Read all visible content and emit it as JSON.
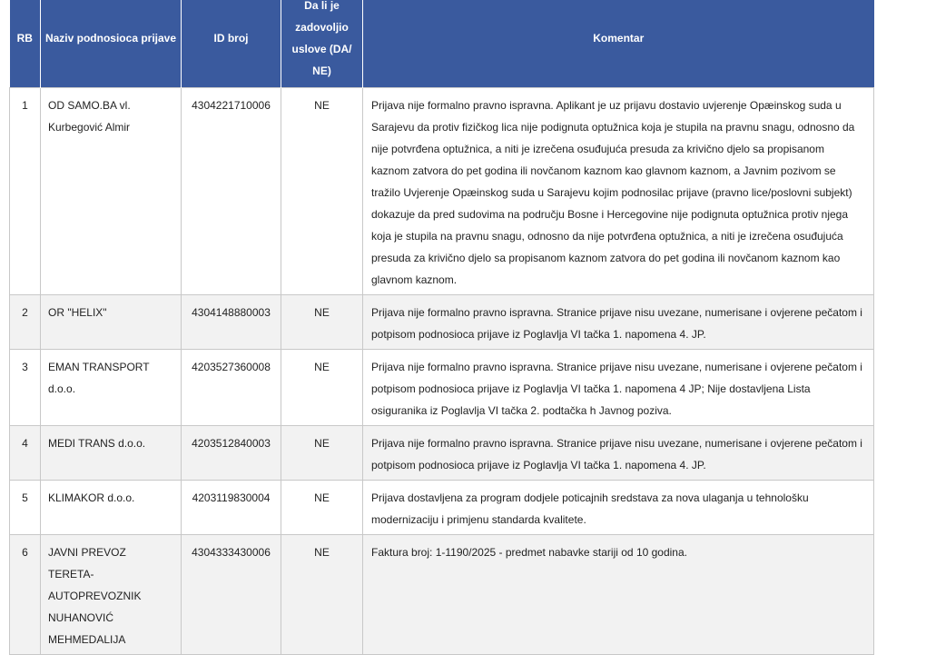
{
  "table": {
    "headers": {
      "rb": "RB",
      "naziv": "Naziv podnosioca prijave",
      "id": "ID broj",
      "da": "Da li je zadovoljio uslove (DA/ NE)",
      "komentar": "Komentar"
    },
    "rows": [
      {
        "rb": "1",
        "naziv": "OD SAMO.BA vl. Kurbegović Almir",
        "id": "4304221710006",
        "da": "NE",
        "komentar": "Prijava nije formalno pravno ispravna. Aplikant je uz prijavu dostavio uvjerenje Opæinskog suda u Sarajevu da protiv fizičkog lica nije podignuta optužnica koja je stupila na pravnu snagu, odnosno da nije potvrđena optužnica, a niti je izrečena osuđujuća presuda za krivično djelo sa propisanom kaznom zatvora do pet godina ili novčanom kaznom kao glavnom kaznom, a Javnim pozivom se tražilo Uvjerenje Opæinskog suda u Sarajevu kojim podnosilac prijave (pravno lice/poslovni subjekt) dokazuje da pred sudovima na području Bosne i Hercegovine nije podignuta optužnica protiv njega koja je stupila na pravnu snagu, odnosno da nije potvrđena optužnica, a niti je izrečena osuđujuća presuda za krivično djelo sa propisanom kaznom zatvora do pet godina ili novčanom kaznom kao glavnom kaznom."
      },
      {
        "rb": "2",
        "naziv": "OR \"HELIX\"",
        "id": "4304148880003",
        "da": "NE",
        "komentar": "Prijava nije formalno pravno ispravna. Stranice prijave nisu uvezane, numerisane i ovjerene pečatom i potpisom podnosioca prijave iz Poglavlja VI tačka 1. napomena 4. JP."
      },
      {
        "rb": "3",
        "naziv": "EMAN TRANSPORT d.o.o.",
        "id": "4203527360008",
        "da": "NE",
        "komentar": "Prijava nije formalno pravno ispravna. Stranice prijave nisu uvezane, numerisane i ovjerene pečatom i potpisom podnosioca prijave iz Poglavlja VI tačka 1. napomena 4 JP; Nije dostavljena Lista osiguranika iz Poglavlja VI tačka 2. podtačka h Javnog poziva."
      },
      {
        "rb": "4",
        "naziv": "MEDI TRANS d.o.o.",
        "id": "4203512840003",
        "da": "NE",
        "komentar": "Prijava nije formalno pravno ispravna. Stranice prijave nisu uvezane, numerisane i ovjerene pečatom i potpisom podnosioca prijave iz Poglavlja VI tačka 1. napomena 4. JP."
      },
      {
        "rb": "5",
        "naziv": "KLIMAKOR d.o.o.",
        "id": "4203119830004",
        "da": "NE",
        "komentar": "Prijava dostavljena za program dodjele poticajnih sredstava za nova ulaganja u tehnološku modernizaciju i primjenu standarda kvalitete."
      },
      {
        "rb": "6",
        "naziv": "JAVNI PREVOZ TERETA-AUTOPREVOZNIK NUHANOVIĆ MEHMEDALIJA",
        "id": "4304333430006",
        "da": "NE",
        "komentar": "Faktura broj: 1-1190/2025 - predmet nabavke stariji od 10 godina."
      }
    ]
  }
}
